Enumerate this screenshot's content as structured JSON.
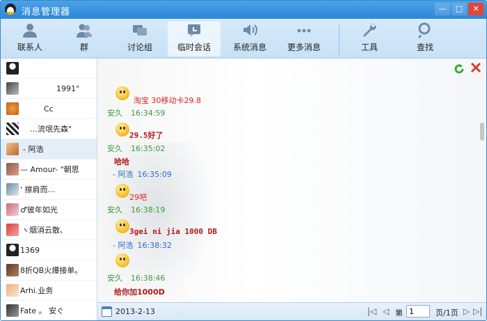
{
  "window": {
    "title": "消息管理器",
    "min": "—",
    "max": "□",
    "close": "✕"
  },
  "toolbar": {
    "items": [
      {
        "label": "联系人",
        "icon": "contacts-icon"
      },
      {
        "label": "群",
        "icon": "group-icon"
      },
      {
        "label": "讨论组",
        "icon": "discussion-icon"
      },
      {
        "label": "临时会话",
        "icon": "temp-session-icon"
      },
      {
        "label": "系统消息",
        "icon": "speaker-icon"
      },
      {
        "label": "更多消息",
        "icon": "more-icon"
      },
      {
        "label": "工具",
        "icon": "wrench-icon"
      },
      {
        "label": "查找",
        "icon": "search-icon"
      }
    ]
  },
  "sidebar": {
    "contacts": [
      {
        "name": ""
      },
      {
        "name": "1991°"
      },
      {
        "name": "Cc"
      },
      {
        "name": "…流氓先森\""
      },
      {
        "name": "- 阿浩"
      },
      {
        "name": "— Amour- \"朝思"
      },
      {
        "name": "'                擦肩而…"
      },
      {
        "name": "♂彼年如光"
      },
      {
        "name": "ヽ烟消云散、"
      },
      {
        "name": "1369"
      },
      {
        "name": "8折QB火爆接单。"
      },
      {
        "name": "Arhi.业务"
      },
      {
        "name": "Fate 。   安ぐ"
      }
    ]
  },
  "chat": {
    "messages": [
      {
        "text": "淘宝 30移动卡29.8",
        "sender": "安久",
        "time": "16:34:59"
      },
      {
        "text": "29.5好了",
        "sender": "安久",
        "time": "16:35:02"
      },
      {
        "text": "哈哈",
        "sender": "- 阿浩",
        "time": "16:35:09"
      },
      {
        "text": "29吧",
        "sender": "安久",
        "time": "16:38:19"
      },
      {
        "text": "3gei ni jia  1000 DB",
        "sender": "- 阿浩",
        "time": "16:38:32"
      },
      {
        "text": "",
        "sender": "安久",
        "time": "16:38:46"
      },
      {
        "text": "给你加1000D",
        "sender": "",
        "time": ""
      }
    ]
  },
  "footer": {
    "date": "2013-2-13",
    "page_prefix": "第",
    "page_value": "1",
    "page_suffix": "页/1页",
    "first": "|◁",
    "prev": "◁",
    "next": "▷",
    "last": "▷|"
  },
  "colors": {
    "accent": "#2e86d6",
    "sender_green": "#3a9a3a",
    "sender_blue": "#2a6fce",
    "message_red": "#d22222"
  }
}
